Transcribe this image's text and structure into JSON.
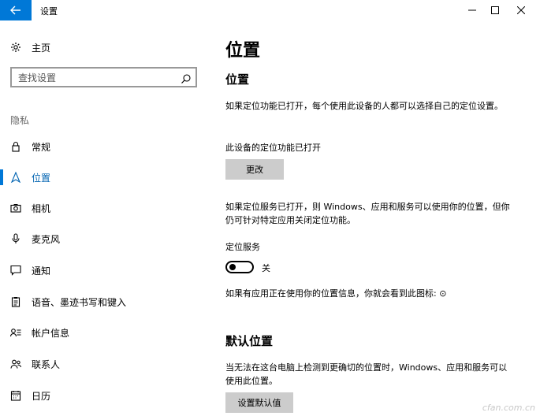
{
  "window": {
    "title": "设置"
  },
  "sidebar": {
    "home_label": "主页",
    "search_placeholder": "查找设置",
    "section_heading": "隐私",
    "items": [
      {
        "label": "常规",
        "icon": "lock-icon"
      },
      {
        "label": "位置",
        "icon": "location-icon",
        "active": true
      },
      {
        "label": "相机",
        "icon": "camera-icon"
      },
      {
        "label": "麦克风",
        "icon": "microphone-icon"
      },
      {
        "label": "通知",
        "icon": "notification-icon"
      },
      {
        "label": "语音、墨迹书写和键入",
        "icon": "clipboard-icon"
      },
      {
        "label": "帐户信息",
        "icon": "account-info-icon"
      },
      {
        "label": "联系人",
        "icon": "contacts-icon"
      },
      {
        "label": "日历",
        "icon": "calendar-icon"
      }
    ]
  },
  "main": {
    "page_title": "位置",
    "location_section": {
      "heading": "位置",
      "description": "如果定位功能已打开，每个使用此设备的人都可以选择自己的定位设置。",
      "device_status": "此设备的定位功能已打开",
      "change_button": "更改",
      "service_description": "如果定位服务已打开，则 Windows、应用和服务可以使用你的位置，但你仍可针对特定应用关闭定位功能。",
      "service_label": "定位服务",
      "toggle_state": "关",
      "toggle_on": false,
      "in_use_notice": "如果有应用正在使用你的位置信息，你就会看到此图标: ⊙"
    },
    "default_location_section": {
      "heading": "默认位置",
      "description": "当无法在这台电脑上检测到更确切的位置时，Windows、应用和服务可以使用此位置。",
      "set_default_button": "设置默认值"
    }
  },
  "watermark": "cfan.com.cn",
  "colors": {
    "accent": "#0078d7",
    "active_text": "#0063b1",
    "button_bg": "#cccccc"
  }
}
